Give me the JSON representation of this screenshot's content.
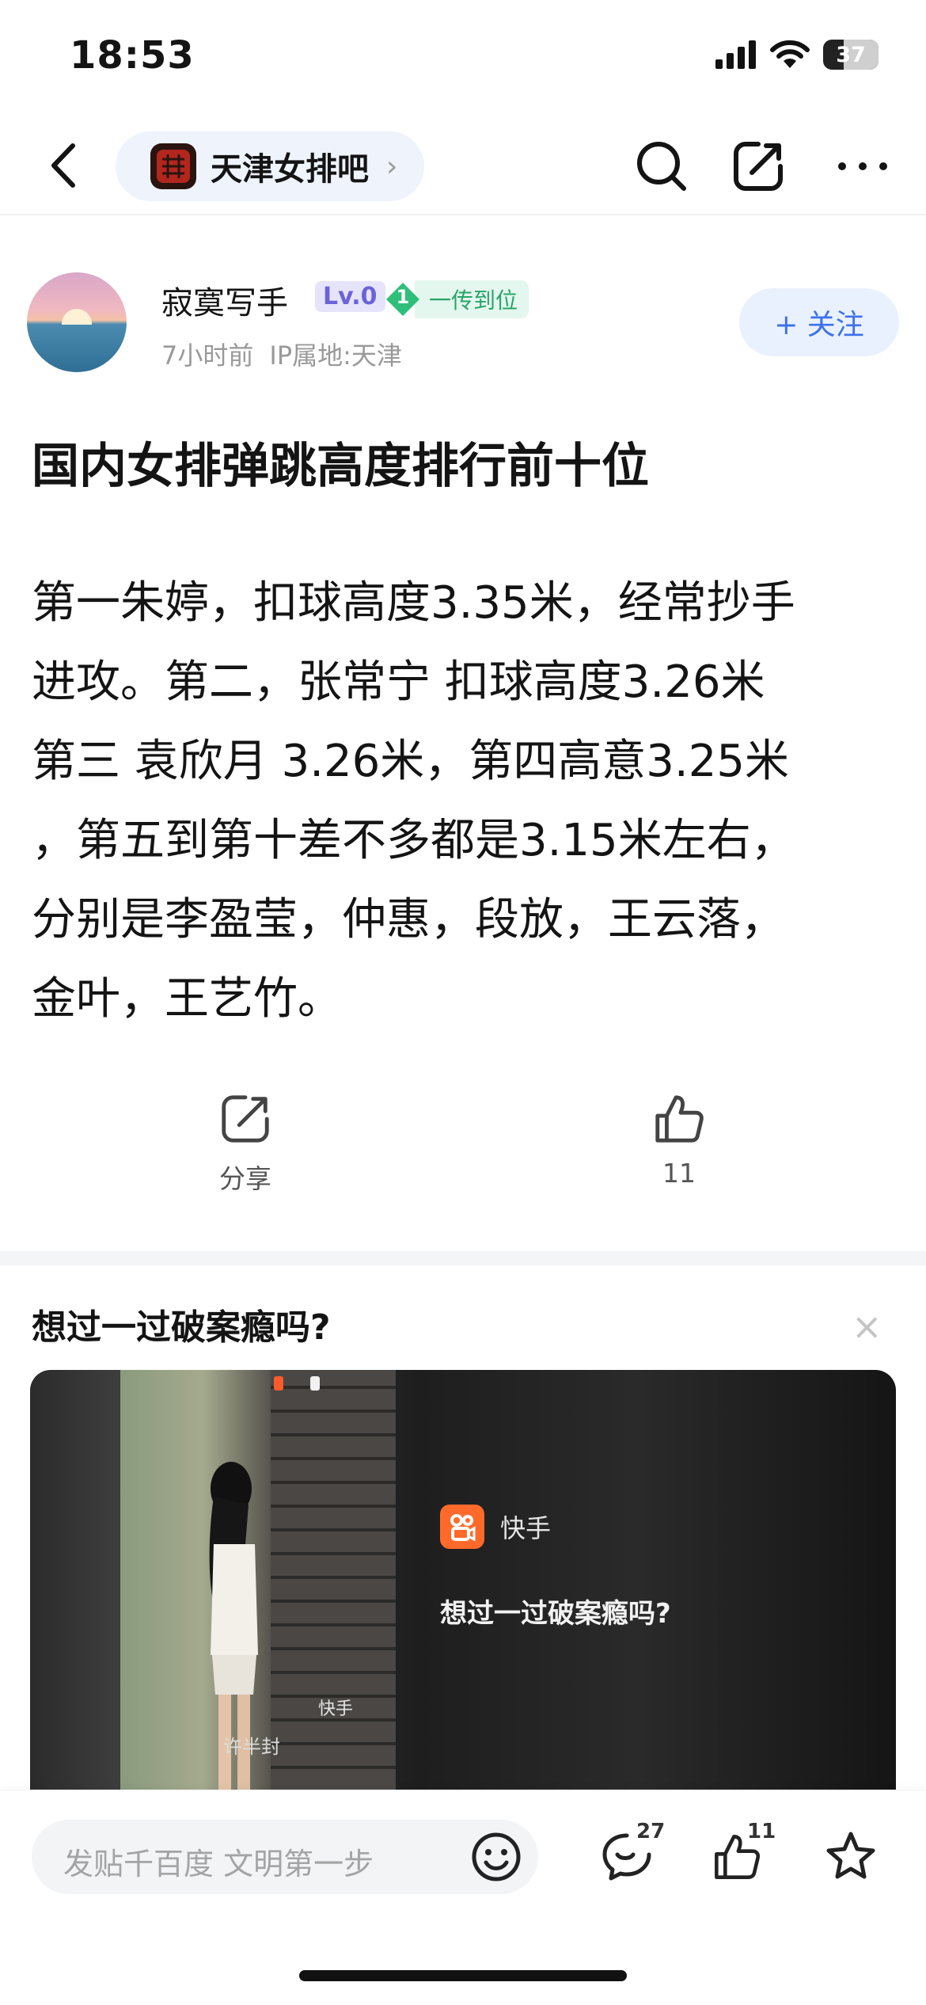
{
  "status_bar": {
    "time": "18:53",
    "battery": "37",
    "battery_level": 0.37
  },
  "nav": {
    "forum_name": "天津女排吧"
  },
  "post": {
    "author": {
      "name": "寂寞写手",
      "level": "Lv.0",
      "honor_number": "1",
      "honor": "一传到位"
    },
    "time_ago": "7小时前",
    "ip_location": "IP属地:天津",
    "follow_label": "+ 关注",
    "title": "国内女排弹跳高度排行前十位",
    "body_lines": [
      "第一朱婷，扣球高度3.35米，经常抄手",
      "进攻。第二，张常宁 扣球高度3.26米",
      "第三 袁欣月 3.26米，第四高意3.25米",
      "，第五到第十差不多都是3.15米左右，",
      "分别是李盈莹，仲惠，段放，王云落，",
      "金叶，王艺竹。"
    ],
    "share_label": "分享",
    "like_count": "11"
  },
  "ad": {
    "title": "想过一过破案瘾吗?",
    "close_symbol": "×",
    "brand": "快手",
    "caption": "想过一过破案瘾吗?",
    "watermark_brand": "快手",
    "watermark_user": "许半封"
  },
  "bottom_bar": {
    "reply_placeholder": "发贴千百度 文明第一步",
    "comment_count": "27",
    "like_count": "11"
  },
  "icons": {
    "back": "chevron-left-icon",
    "search": "search-icon",
    "share_nav": "share-icon",
    "more": "more-icon",
    "thumb": "thumb-up-icon",
    "emoji": "emoji-icon",
    "comment": "comment-icon",
    "star": "star-icon"
  },
  "colors": {
    "accent": "#3d72e8",
    "honor_green": "#27a46a",
    "level_purple": "#6b63d8",
    "kuaishou_orange": "#ff6a2b"
  }
}
